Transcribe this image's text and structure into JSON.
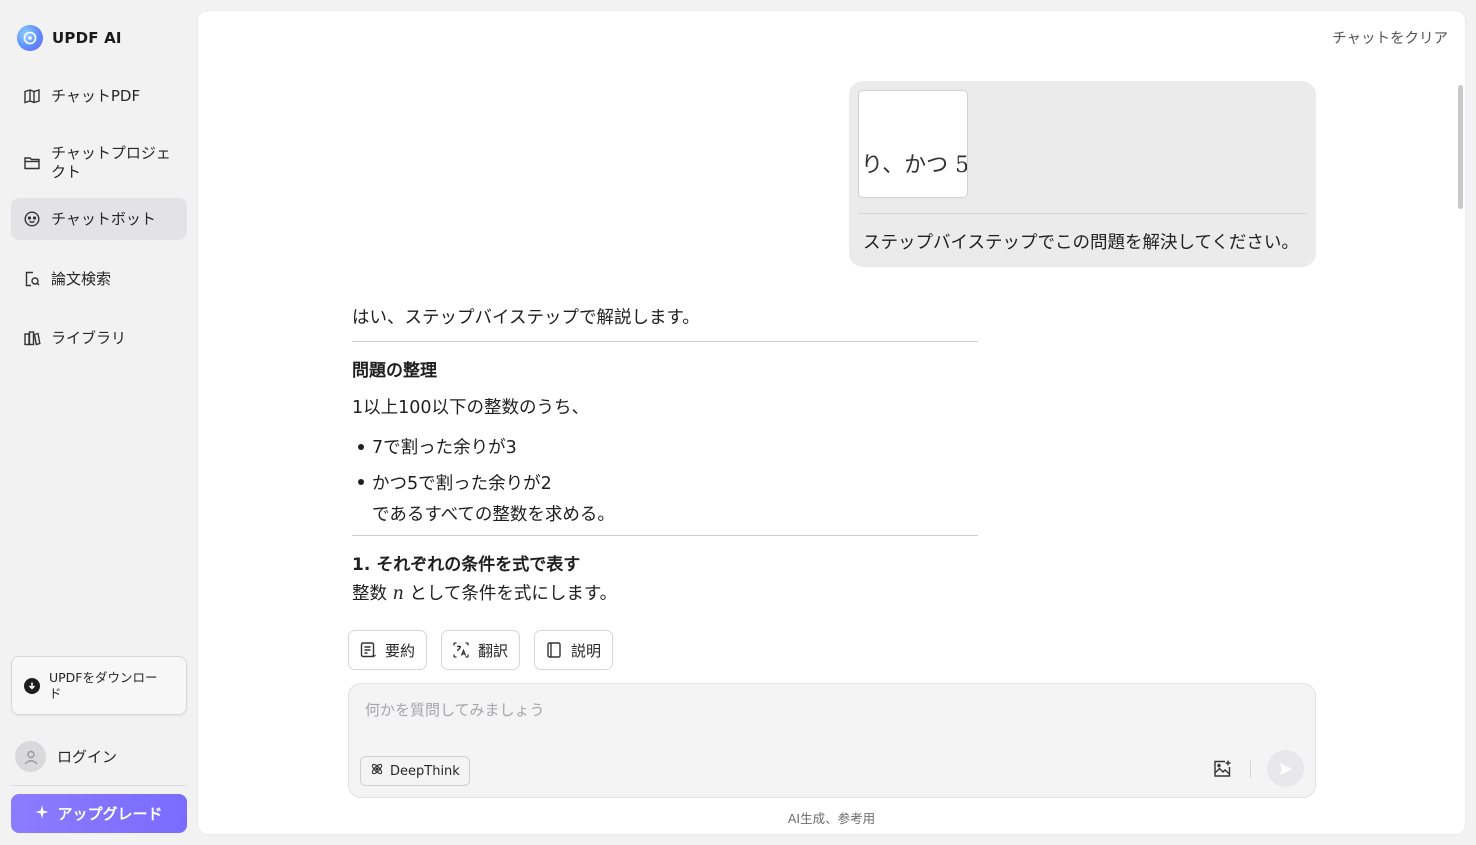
{
  "app": {
    "title": "UPDF AI"
  },
  "sidebar": {
    "items": [
      {
        "label": "チャットPDF",
        "icon": "book-chat-icon"
      },
      {
        "label": "チャットプロジェクト",
        "icon": "folder-chat-icon"
      },
      {
        "label": "チャットボット",
        "icon": "bot-chat-icon",
        "active": true
      },
      {
        "label": "論文検索",
        "icon": "document-search-icon"
      },
      {
        "label": "ライブラリ",
        "icon": "library-icon"
      }
    ],
    "download_label": "UPDFをダウンロード",
    "login_label": "ログイン",
    "upgrade_label": "アップグレード"
  },
  "header": {
    "clear_chat": "チャットをクリア"
  },
  "conversation": {
    "user": {
      "image_text": "り、かつ 5",
      "text": "ステップバイステップでこの問題を解決してください。"
    },
    "assistant": {
      "intro": "はい、ステップバイステップで解説します。",
      "heading1": "問題の整理",
      "para1": "1以上100以下の整数のうち、",
      "bullet1": "7で割った余りが3",
      "bullet2_line1": "かつ5で割った余りが2",
      "bullet2_line2": "であるすべての整数を求める。",
      "heading2": "1. それぞれの条件を式で表す",
      "para2_pre": "整数 ",
      "para2_var": "n",
      "para2_post": " として条件を式にします。"
    }
  },
  "actions": {
    "summarize": "要約",
    "translate": "翻訳",
    "explain": "説明"
  },
  "composer": {
    "placeholder": "何かを質問してみましょう",
    "value": "",
    "deepthink_label": "DeepThink"
  },
  "footer": {
    "note": "AI生成、参考用"
  },
  "colors": {
    "accent": "#7d6eff",
    "active_nav": "#e3e3e5"
  }
}
